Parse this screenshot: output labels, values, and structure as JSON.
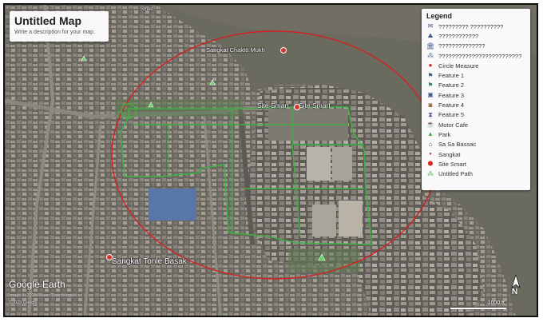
{
  "title_card": {
    "title": "Untitled Map",
    "description": "Write a description for your map."
  },
  "legend": {
    "title": "Legend",
    "items": [
      {
        "label": "????????? ??????????",
        "icon": "speech-bubble-icon"
      },
      {
        "label": "????????????",
        "icon": "landmark-icon"
      },
      {
        "label": "??????????????",
        "icon": "temple-icon"
      },
      {
        "label": "?????????????????????????",
        "icon": "cluster-icon"
      },
      {
        "label": "Circle Measure",
        "icon": "circle-measure-icon"
      },
      {
        "label": "Feature 1",
        "icon": "flag-icon"
      },
      {
        "label": "Feature 2",
        "icon": "green-flag-icon"
      },
      {
        "label": "Feature 3",
        "icon": "building-icon"
      },
      {
        "label": "Feature 4",
        "icon": "square-icon"
      },
      {
        "label": "Feature 5",
        "icon": "monument-icon"
      },
      {
        "label": "Motor Cafe",
        "icon": "cafe-icon"
      },
      {
        "label": "Park",
        "icon": "tree-icon"
      },
      {
        "label": "Sa Sa Bassac",
        "icon": "gallery-icon"
      },
      {
        "label": "Sangkat",
        "icon": "red-dot-icon"
      },
      {
        "label": "Site Smart",
        "icon": "red-pin-icon"
      },
      {
        "label": "Untitled Path",
        "icon": "path-icon"
      }
    ]
  },
  "places": {
    "sangkat_chaktomukh": "Sangkat Chaktō Mukh",
    "site_smart_1": "Site Smart",
    "site_smart_2": "Site Smart",
    "sangkat_tonle_basak": "Sangkat Tonle Basak",
    "top_street_label": "Street"
  },
  "branding": {
    "logo": "Google Earth",
    "credit_1": "Image © 2025 Maxar Technologies",
    "credit_2": "©2025 Google",
    "scale_label": "1000 ft",
    "north": "N"
  },
  "colors": {
    "river": "#6b6a5f",
    "city": "#6e6a66",
    "circle": "#d42020",
    "path": "#3cb043"
  }
}
